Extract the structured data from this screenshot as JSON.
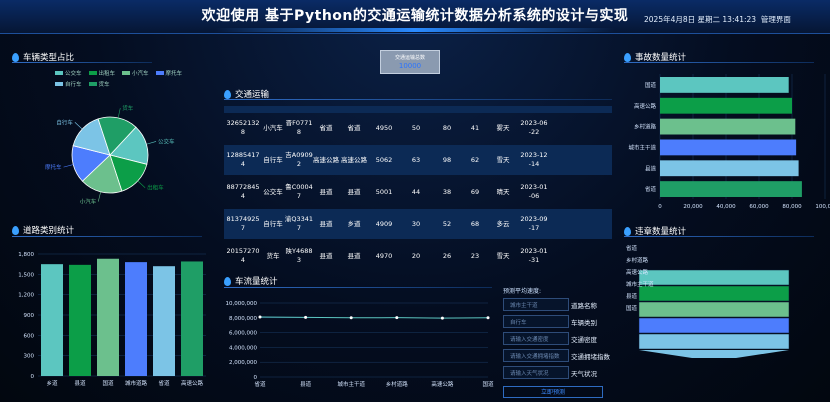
{
  "header": {
    "title": "欢迎使用 基于Python的交通运输统计数据分析系统的设计与实现",
    "datetime": "2025年4月8日 星期二 13:41:23",
    "admin_label": "管理界面"
  },
  "center_stat": {
    "label": "交通运输总数",
    "value": "10000"
  },
  "panels": {
    "vehicle": {
      "title": "车辆类型占比",
      "legend": [
        "公交车",
        "出租车",
        "小汽车",
        "摩托车",
        "自行车",
        "货车"
      ]
    },
    "traffic": {
      "title": "交通运输"
    },
    "road": {
      "title": "道路类别统计"
    },
    "flow": {
      "title": "车流量统计"
    },
    "accident": {
      "title": "事故数量统计"
    },
    "violation": {
      "title": "违章数量统计"
    }
  },
  "colors": {
    "teal": "#5cc6c0",
    "green": "#0c9e48",
    "mint": "#6cc08d",
    "blue": "#4d7dfd",
    "sky": "#7cc4e6",
    "dkgreen": "#1f9e66"
  },
  "table_rows": [
    [
      "32652132\n8",
      "小汽车",
      "晋F0771\n8",
      "省道",
      "省道",
      "4950",
      "50",
      "80",
      "41",
      "雾天",
      "2023-06\n-22"
    ],
    [
      "12885417\n4",
      "自行车",
      "吉A0909\n2",
      "高速公路",
      "高速公路",
      "5062",
      "63",
      "98",
      "62",
      "雪天",
      "2023-12\n-14"
    ],
    [
      "88772845\n4",
      "公交车",
      "鲁C0004\n7",
      "县道",
      "县道",
      "5001",
      "44",
      "38",
      "69",
      "晴天",
      "2023-01\n-06"
    ],
    [
      "81374925\n7",
      "自行车",
      "渝Q3341\n7",
      "县道",
      "乡道",
      "4909",
      "30",
      "52",
      "68",
      "多云",
      "2023-09\n-17"
    ],
    [
      "20157270\n4",
      "货车",
      "陕Y4688\n3",
      "县道",
      "县道",
      "4970",
      "20",
      "26",
      "23",
      "雪天",
      "2023-01\n-31"
    ]
  ],
  "chart_data": [
    {
      "type": "pie",
      "title": "车辆类型占比",
      "labels": [
        "公交车",
        "出租车",
        "小汽车",
        "摩托车",
        "自行车",
        "货车"
      ],
      "values": [
        17,
        16,
        18,
        16,
        16,
        17
      ]
    },
    {
      "type": "bar",
      "title": "道路类别统计",
      "categories": [
        "乡道",
        "县道",
        "国道",
        "城市道路",
        "省道",
        "高速公路"
      ],
      "values": [
        1650,
        1640,
        1730,
        1680,
        1620,
        1690
      ],
      "ylim": [
        0,
        1800
      ],
      "yticks": [
        "0",
        "300",
        "600",
        "900",
        "1,200",
        "1,500",
        "1,800"
      ]
    },
    {
      "type": "line",
      "title": "车流量统计",
      "categories": [
        "省道",
        "县道",
        "城市主干道",
        "乡村道路",
        "高速公路",
        "国道"
      ],
      "values": [
        8100000,
        8050000,
        8000000,
        8020000,
        7950000,
        8010000
      ],
      "ylim": [
        0,
        10000000
      ],
      "yticks": [
        "0",
        "2,000,000",
        "4,000,000",
        "6,000,000",
        "8,000,000",
        "10,000,000"
      ]
    },
    {
      "type": "bar",
      "title": "事故数量统计",
      "categories": [
        "国道",
        "高速公路",
        "乡村道路",
        "城市主干道",
        "县道",
        "省道"
      ],
      "values": [
        78000,
        80000,
        82000,
        82500,
        84000,
        86000
      ],
      "xlim": [
        0,
        100000
      ],
      "xticks": [
        "0",
        "20,000",
        "40,000",
        "60,000",
        "80,000",
        "100,00"
      ]
    },
    {
      "type": "funnel",
      "title": "违章数量统计",
      "labels": [
        "省道",
        "乡村道路",
        "高速公路",
        "城市主干道",
        "县道",
        "国道"
      ]
    }
  ],
  "form": {
    "title": "预测平均速度:",
    "fields": [
      {
        "placeholder": "城市主干道",
        "label": "道路名称"
      },
      {
        "placeholder": "自行车",
        "label": "车辆类别"
      },
      {
        "placeholder": "请输入交通密度",
        "label": "交通密度"
      },
      {
        "placeholder": "请输入交通拥堵指数",
        "label": "交通拥堵指数"
      },
      {
        "placeholder": "请输入天气状况",
        "label": "天气状况"
      }
    ],
    "submit": "立即预测"
  }
}
